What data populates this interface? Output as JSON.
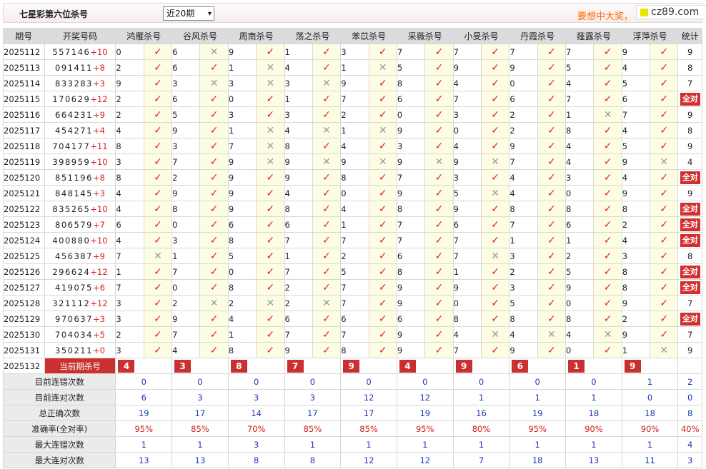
{
  "header": {
    "title": "七星彩第六位杀号",
    "period_select": "近20期",
    "promo": "要想中大奖，",
    "logo": "cz89.com"
  },
  "columns": [
    "期号",
    "开奖号码",
    "鸿雁杀号",
    "谷风杀号",
    "周南杀号",
    "荡之杀号",
    "苯苡杀号",
    "采薇杀号",
    "小旻杀号",
    "丹霞杀号",
    "薤露杀号",
    "浮萍杀号",
    "统计"
  ],
  "rows": [
    {
      "period": "2025112",
      "nums": "557146",
      "sum": "+10",
      "kills": [
        [
          "0",
          true
        ],
        [
          "6",
          false
        ],
        [
          "9",
          true
        ],
        [
          "1",
          true
        ],
        [
          "3",
          true
        ],
        [
          "7",
          true
        ],
        [
          "7",
          true
        ],
        [
          "7",
          true
        ],
        [
          "7",
          true
        ],
        [
          "9",
          true
        ]
      ],
      "tally": "9"
    },
    {
      "period": "2025113",
      "nums": "091411",
      "sum": "+8",
      "kills": [
        [
          "2",
          true
        ],
        [
          "6",
          true
        ],
        [
          "1",
          false
        ],
        [
          "4",
          true
        ],
        [
          "1",
          false
        ],
        [
          "5",
          true
        ],
        [
          "9",
          true
        ],
        [
          "9",
          true
        ],
        [
          "5",
          true
        ],
        [
          "4",
          true
        ]
      ],
      "tally": "8"
    },
    {
      "period": "2025114",
      "nums": "833283",
      "sum": "+3",
      "kills": [
        [
          "9",
          true
        ],
        [
          "3",
          false
        ],
        [
          "3",
          false
        ],
        [
          "3",
          false
        ],
        [
          "9",
          true
        ],
        [
          "8",
          true
        ],
        [
          "4",
          true
        ],
        [
          "0",
          true
        ],
        [
          "4",
          true
        ],
        [
          "5",
          true
        ]
      ],
      "tally": "7"
    },
    {
      "period": "2025115",
      "nums": "170629",
      "sum": "+12",
      "kills": [
        [
          "2",
          true
        ],
        [
          "6",
          true
        ],
        [
          "0",
          true
        ],
        [
          "1",
          true
        ],
        [
          "7",
          true
        ],
        [
          "6",
          true
        ],
        [
          "7",
          true
        ],
        [
          "6",
          true
        ],
        [
          "7",
          true
        ],
        [
          "6",
          true
        ]
      ],
      "tally": "全对"
    },
    {
      "period": "2025116",
      "nums": "664231",
      "sum": "+9",
      "kills": [
        [
          "2",
          true
        ],
        [
          "5",
          true
        ],
        [
          "3",
          true
        ],
        [
          "3",
          true
        ],
        [
          "2",
          true
        ],
        [
          "0",
          true
        ],
        [
          "3",
          true
        ],
        [
          "2",
          true
        ],
        [
          "1",
          false
        ],
        [
          "7",
          true
        ]
      ],
      "tally": "9"
    },
    {
      "period": "2025117",
      "nums": "454271",
      "sum": "+4",
      "kills": [
        [
          "4",
          true
        ],
        [
          "9",
          true
        ],
        [
          "1",
          false
        ],
        [
          "4",
          false
        ],
        [
          "1",
          false
        ],
        [
          "9",
          true
        ],
        [
          "0",
          true
        ],
        [
          "2",
          true
        ],
        [
          "8",
          true
        ],
        [
          "4",
          true
        ]
      ],
      "tally": "8"
    },
    {
      "period": "2025118",
      "nums": "704177",
      "sum": "+11",
      "kills": [
        [
          "8",
          true
        ],
        [
          "3",
          true
        ],
        [
          "7",
          false
        ],
        [
          "8",
          true
        ],
        [
          "4",
          true
        ],
        [
          "3",
          true
        ],
        [
          "4",
          true
        ],
        [
          "9",
          true
        ],
        [
          "4",
          true
        ],
        [
          "5",
          true
        ]
      ],
      "tally": "9"
    },
    {
      "period": "2025119",
      "nums": "398959",
      "sum": "+10",
      "kills": [
        [
          "3",
          true
        ],
        [
          "7",
          true
        ],
        [
          "9",
          false
        ],
        [
          "9",
          false
        ],
        [
          "9",
          false
        ],
        [
          "9",
          false
        ],
        [
          "9",
          false
        ],
        [
          "7",
          true
        ],
        [
          "4",
          true
        ],
        [
          "9",
          false
        ]
      ],
      "tally": "4"
    },
    {
      "period": "2025120",
      "nums": "851196",
      "sum": "+8",
      "kills": [
        [
          "8",
          true
        ],
        [
          "2",
          true
        ],
        [
          "9",
          true
        ],
        [
          "9",
          true
        ],
        [
          "8",
          true
        ],
        [
          "7",
          true
        ],
        [
          "3",
          true
        ],
        [
          "4",
          true
        ],
        [
          "3",
          true
        ],
        [
          "4",
          true
        ]
      ],
      "tally": "全对"
    },
    {
      "period": "2025121",
      "nums": "848145",
      "sum": "+3",
      "kills": [
        [
          "4",
          true
        ],
        [
          "9",
          true
        ],
        [
          "9",
          true
        ],
        [
          "4",
          true
        ],
        [
          "0",
          true
        ],
        [
          "9",
          true
        ],
        [
          "5",
          false
        ],
        [
          "4",
          true
        ],
        [
          "0",
          true
        ],
        [
          "9",
          true
        ]
      ],
      "tally": "9"
    },
    {
      "period": "2025122",
      "nums": "835265",
      "sum": "+10",
      "kills": [
        [
          "4",
          true
        ],
        [
          "8",
          true
        ],
        [
          "9",
          true
        ],
        [
          "8",
          true
        ],
        [
          "4",
          true
        ],
        [
          "8",
          true
        ],
        [
          "9",
          true
        ],
        [
          "8",
          true
        ],
        [
          "8",
          true
        ],
        [
          "8",
          true
        ]
      ],
      "tally": "全对"
    },
    {
      "period": "2025123",
      "nums": "806579",
      "sum": "+7",
      "kills": [
        [
          "6",
          true
        ],
        [
          "0",
          true
        ],
        [
          "6",
          true
        ],
        [
          "6",
          true
        ],
        [
          "1",
          true
        ],
        [
          "7",
          true
        ],
        [
          "6",
          true
        ],
        [
          "7",
          true
        ],
        [
          "6",
          true
        ],
        [
          "2",
          true
        ]
      ],
      "tally": "全对"
    },
    {
      "period": "2025124",
      "nums": "400880",
      "sum": "+10",
      "kills": [
        [
          "4",
          true
        ],
        [
          "3",
          true
        ],
        [
          "8",
          true
        ],
        [
          "7",
          true
        ],
        [
          "7",
          true
        ],
        [
          "7",
          true
        ],
        [
          "7",
          true
        ],
        [
          "1",
          true
        ],
        [
          "1",
          true
        ],
        [
          "4",
          true
        ]
      ],
      "tally": "全对"
    },
    {
      "period": "2025125",
      "nums": "456387",
      "sum": "+9",
      "kills": [
        [
          "7",
          false
        ],
        [
          "1",
          true
        ],
        [
          "5",
          true
        ],
        [
          "1",
          true
        ],
        [
          "2",
          true
        ],
        [
          "6",
          true
        ],
        [
          "7",
          false
        ],
        [
          "3",
          true
        ],
        [
          "2",
          true
        ],
        [
          "3",
          true
        ]
      ],
      "tally": "8"
    },
    {
      "period": "2025126",
      "nums": "296624",
      "sum": "+12",
      "kills": [
        [
          "1",
          true
        ],
        [
          "7",
          true
        ],
        [
          "0",
          true
        ],
        [
          "7",
          true
        ],
        [
          "5",
          true
        ],
        [
          "8",
          true
        ],
        [
          "1",
          true
        ],
        [
          "2",
          true
        ],
        [
          "5",
          true
        ],
        [
          "8",
          true
        ]
      ],
      "tally": "全对"
    },
    {
      "period": "2025127",
      "nums": "419075",
      "sum": "+6",
      "kills": [
        [
          "7",
          true
        ],
        [
          "0",
          true
        ],
        [
          "8",
          true
        ],
        [
          "2",
          true
        ],
        [
          "7",
          true
        ],
        [
          "9",
          true
        ],
        [
          "9",
          true
        ],
        [
          "3",
          true
        ],
        [
          "9",
          true
        ],
        [
          "8",
          true
        ]
      ],
      "tally": "全对"
    },
    {
      "period": "2025128",
      "nums": "321112",
      "sum": "+12",
      "kills": [
        [
          "3",
          true
        ],
        [
          "2",
          false
        ],
        [
          "2",
          false
        ],
        [
          "2",
          false
        ],
        [
          "7",
          true
        ],
        [
          "9",
          true
        ],
        [
          "0",
          true
        ],
        [
          "5",
          true
        ],
        [
          "0",
          true
        ],
        [
          "9",
          true
        ]
      ],
      "tally": "7"
    },
    {
      "period": "2025129",
      "nums": "970637",
      "sum": "+3",
      "kills": [
        [
          "3",
          true
        ],
        [
          "9",
          true
        ],
        [
          "4",
          true
        ],
        [
          "6",
          true
        ],
        [
          "6",
          true
        ],
        [
          "6",
          true
        ],
        [
          "8",
          true
        ],
        [
          "8",
          true
        ],
        [
          "8",
          true
        ],
        [
          "2",
          true
        ]
      ],
      "tally": "全对"
    },
    {
      "period": "2025130",
      "nums": "704034",
      "sum": "+5",
      "kills": [
        [
          "2",
          true
        ],
        [
          "7",
          true
        ],
        [
          "1",
          true
        ],
        [
          "7",
          true
        ],
        [
          "7",
          true
        ],
        [
          "9",
          true
        ],
        [
          "4",
          false
        ],
        [
          "4",
          false
        ],
        [
          "4",
          false
        ],
        [
          "9",
          true
        ]
      ],
      "tally": "7"
    },
    {
      "period": "2025131",
      "nums": "350211",
      "sum": "+0",
      "kills": [
        [
          "3",
          true
        ],
        [
          "4",
          true
        ],
        [
          "8",
          true
        ],
        [
          "9",
          true
        ],
        [
          "8",
          true
        ],
        [
          "9",
          true
        ],
        [
          "7",
          true
        ],
        [
          "9",
          true
        ],
        [
          "0",
          true
        ],
        [
          "1",
          false
        ]
      ],
      "tally": "9"
    }
  ],
  "current": {
    "period": "2025132",
    "label": "当前期杀号",
    "values": [
      "4",
      "3",
      "8",
      "7",
      "9",
      "4",
      "9",
      "6",
      "1",
      "9"
    ]
  },
  "stats": [
    {
      "label": "目前连错次数",
      "values": [
        "0",
        "0",
        "0",
        "0",
        "0",
        "0",
        "0",
        "0",
        "0",
        "1"
      ],
      "tally": "2",
      "rate": false
    },
    {
      "label": "目前连对次数",
      "values": [
        "6",
        "3",
        "3",
        "3",
        "12",
        "12",
        "1",
        "1",
        "1",
        "0"
      ],
      "tally": "0",
      "rate": false
    },
    {
      "label": "总正确次数",
      "values": [
        "19",
        "17",
        "14",
        "17",
        "17",
        "19",
        "16",
        "19",
        "18",
        "18"
      ],
      "tally": "8",
      "rate": false
    },
    {
      "label": "准确率(全对率)",
      "values": [
        "95%",
        "85%",
        "70%",
        "85%",
        "85%",
        "95%",
        "80%",
        "95%",
        "90%",
        "90%"
      ],
      "tally": "40%",
      "rate": true
    },
    {
      "label": "最大连错次数",
      "values": [
        "1",
        "1",
        "3",
        "1",
        "1",
        "1",
        "1",
        "1",
        "1",
        "1"
      ],
      "tally": "4",
      "rate": false
    },
    {
      "label": "最大连对次数",
      "values": [
        "13",
        "13",
        "8",
        "8",
        "12",
        "12",
        "7",
        "18",
        "13",
        "11"
      ],
      "tally": "3",
      "rate": false
    }
  ],
  "icons": {
    "correct": "check-icon",
    "wrong": "cross-icon"
  },
  "colors": {
    "accent": "#c8312f",
    "correct": "#e02020",
    "wrong": "#9a9a9a",
    "stat": "#1a3bb0",
    "promo": "#ff6a00"
  }
}
